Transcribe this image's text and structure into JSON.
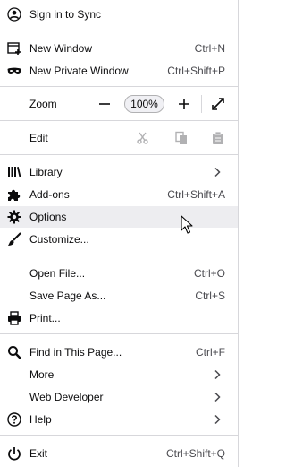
{
  "menu": {
    "sync_label": "Sign in to Sync",
    "new_window": {
      "label": "New Window",
      "shortcut": "Ctrl+N"
    },
    "new_private": {
      "label": "New Private Window",
      "shortcut": "Ctrl+Shift+P"
    },
    "zoom": {
      "label": "Zoom",
      "value": "100%"
    },
    "edit": {
      "label": "Edit"
    },
    "library": {
      "label": "Library"
    },
    "addons": {
      "label": "Add-ons",
      "shortcut": "Ctrl+Shift+A"
    },
    "options": {
      "label": "Options"
    },
    "customize": {
      "label": "Customize..."
    },
    "open_file": {
      "label": "Open File...",
      "shortcut": "Ctrl+O"
    },
    "save_page": {
      "label": "Save Page As...",
      "shortcut": "Ctrl+S"
    },
    "print": {
      "label": "Print..."
    },
    "find": {
      "label": "Find in This Page...",
      "shortcut": "Ctrl+F"
    },
    "more": {
      "label": "More"
    },
    "web_dev": {
      "label": "Web Developer"
    },
    "help": {
      "label": "Help"
    },
    "exit": {
      "label": "Exit",
      "shortcut": "Ctrl+Shift+Q"
    }
  },
  "colors": {
    "text": "#0c0c0d",
    "hover": "#ededf0",
    "separator": "#d7d7db",
    "disabled": "#b1b1b3"
  }
}
